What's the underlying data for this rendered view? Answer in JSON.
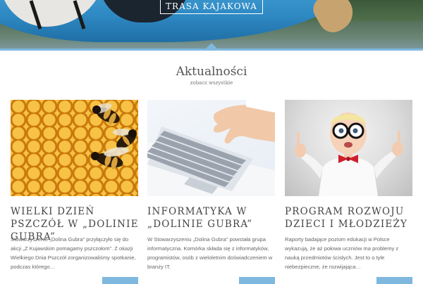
{
  "hero": {
    "button_label": "TRASA KAJAKOWA"
  },
  "news": {
    "title": "Aktualności",
    "see_all": "zobacz wszystkie",
    "items": [
      {
        "title": "WIELKI DZIEŃ PSZCZÓŁ W „DOLINIE GUBRA”",
        "text": "Stowarzyszenie „Dolina Gubra” przyłączyło się do akcji „Z Kujawskim pomagamy pszczołom”. Z okazji Wielkiego Dnia Pszczół zorganizowaliśmy spotkanie, podczas którego…",
        "image": "honeycomb-bees"
      },
      {
        "title": "INFORMATYKA W „DOLINIE GUBRA”",
        "text": "W Stowarzyszeniu „Dolina Gubra” powstała grupa informatyczna. Komórka składa się z informatyków, programistów, osób z wieloletnim doświadczeniem w branży IT.",
        "image": "laptop-keyboard"
      },
      {
        "title": "PROGRAM ROZWOJU DZIECI I MŁODZIEŻY",
        "text": "Raporty badające poziom edukacji w Polsce wykazują, że aż połowa uczniów ma problemy z nauką przedmiotów ścisłych. Jest to o tyle niebezpieczne, że rozwijająca…",
        "image": "child-with-glasses"
      }
    ]
  },
  "colors": {
    "accent": "#7fb8de",
    "heading": "#444444",
    "body_text": "#666666"
  }
}
